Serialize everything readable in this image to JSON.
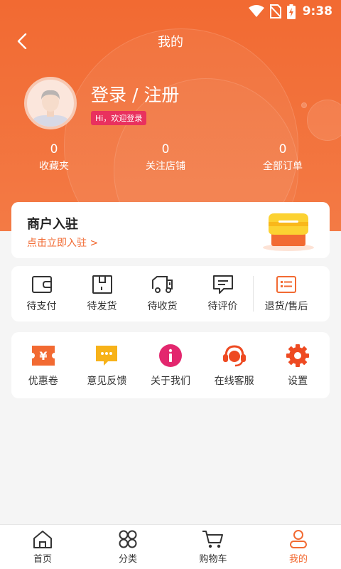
{
  "status_bar": {
    "time": "9:38"
  },
  "nav": {
    "title": "我的"
  },
  "profile": {
    "login_label": "登录 / 注册",
    "welcome": "Hi，欢迎登录"
  },
  "stats": [
    {
      "count": "0",
      "label": "收藏夹"
    },
    {
      "count": "0",
      "label": "关注店铺"
    },
    {
      "count": "0",
      "label": "全部订单"
    }
  ],
  "merchant": {
    "title": "商户入驻",
    "link": "点击立即入驻 >"
  },
  "orders": [
    {
      "label": "待支付",
      "icon": "wallet-icon"
    },
    {
      "label": "待发货",
      "icon": "package-icon"
    },
    {
      "label": "待收货",
      "icon": "delivery-truck-icon"
    },
    {
      "label": "待评价",
      "icon": "comment-icon"
    },
    {
      "label": "退货/售后",
      "icon": "refund-list-icon"
    }
  ],
  "services": [
    {
      "label": "优惠卷",
      "icon": "coupon-icon"
    },
    {
      "label": "意见反馈",
      "icon": "feedback-icon"
    },
    {
      "label": "关于我们",
      "icon": "info-icon"
    },
    {
      "label": "在线客服",
      "icon": "headset-icon"
    },
    {
      "label": "设置",
      "icon": "gear-icon"
    }
  ],
  "tabs": [
    {
      "label": "首页",
      "icon": "home-icon"
    },
    {
      "label": "分类",
      "icon": "category-icon"
    },
    {
      "label": "购物车",
      "icon": "cart-icon"
    },
    {
      "label": "我的",
      "icon": "user-icon",
      "active": true
    }
  ],
  "colors": {
    "accent": "#f26a32",
    "badge": "#e9315e",
    "background": "#f5f5f5"
  }
}
